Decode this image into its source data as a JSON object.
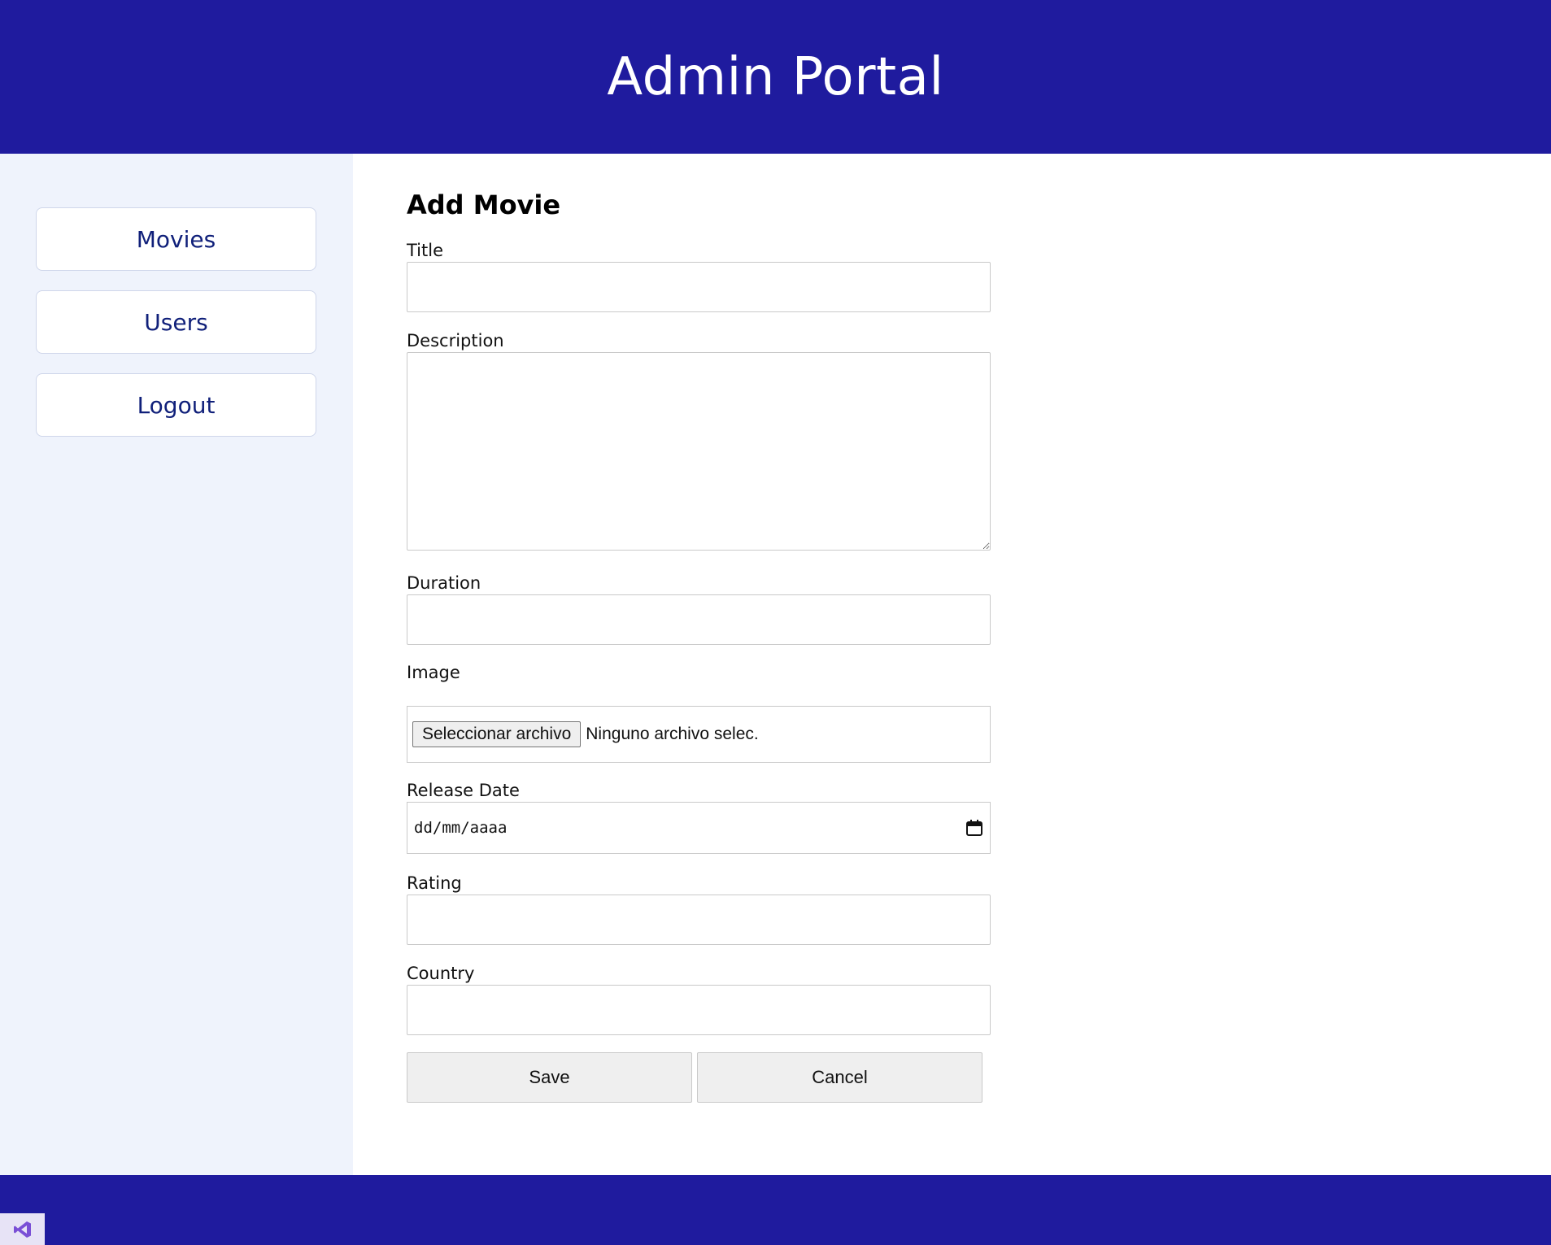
{
  "header": {
    "title": "Admin Portal"
  },
  "sidebar": {
    "items": [
      {
        "label": "Movies"
      },
      {
        "label": "Users"
      },
      {
        "label": "Logout"
      }
    ]
  },
  "form": {
    "title": "Add Movie",
    "fields": {
      "title": {
        "label": "Title",
        "value": ""
      },
      "description": {
        "label": "Description",
        "value": ""
      },
      "duration": {
        "label": "Duration",
        "value": ""
      },
      "image": {
        "label": "Image",
        "button_label": "Seleccionar archivo",
        "status": "Ninguno archivo selec."
      },
      "release_date": {
        "label": "Release Date",
        "placeholder": "dd/mm/aaaa"
      },
      "rating": {
        "label": "Rating",
        "value": ""
      },
      "country": {
        "label": "Country",
        "value": ""
      }
    },
    "save_label": "Save",
    "cancel_label": "Cancel"
  },
  "colors": {
    "brand": "#1f1b9e",
    "sidebar_bg": "#eff3fc",
    "nav_text": "#10207a"
  },
  "icons": {
    "calendar": "calendar-icon",
    "vs_badge": "visual-studio-icon"
  }
}
